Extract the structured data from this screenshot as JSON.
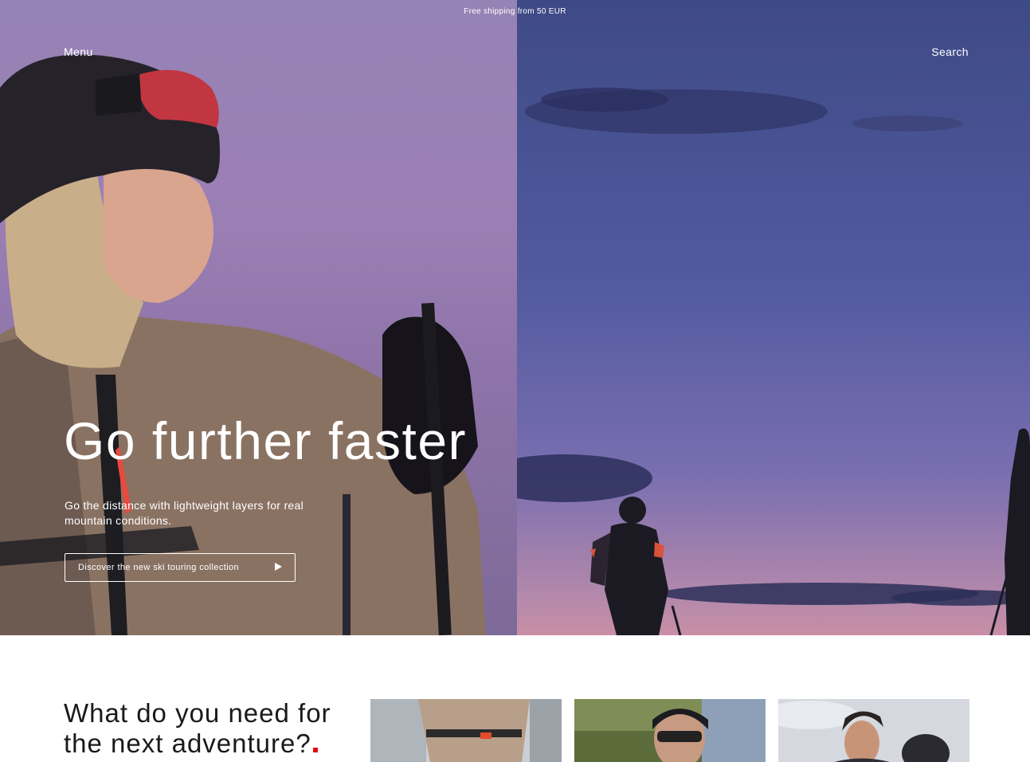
{
  "promo_bar": {
    "text": "Free shipping from 50 EUR"
  },
  "header": {
    "menu_label": "Menu",
    "search_label": "Search"
  },
  "hero": {
    "headline": "Go further faster",
    "lead": "Go the distance with lightweight layers for real mountain conditions.",
    "cta_label": "Discover the new ski touring collection",
    "cta_icon": "arrow-right-icon",
    "accent_color": "#e30613"
  },
  "adventure_section": {
    "title": "What do you need for the next adventure?",
    "cards": [
      {
        "name": "category-card-1"
      },
      {
        "name": "category-card-2"
      },
      {
        "name": "category-card-3"
      }
    ]
  }
}
